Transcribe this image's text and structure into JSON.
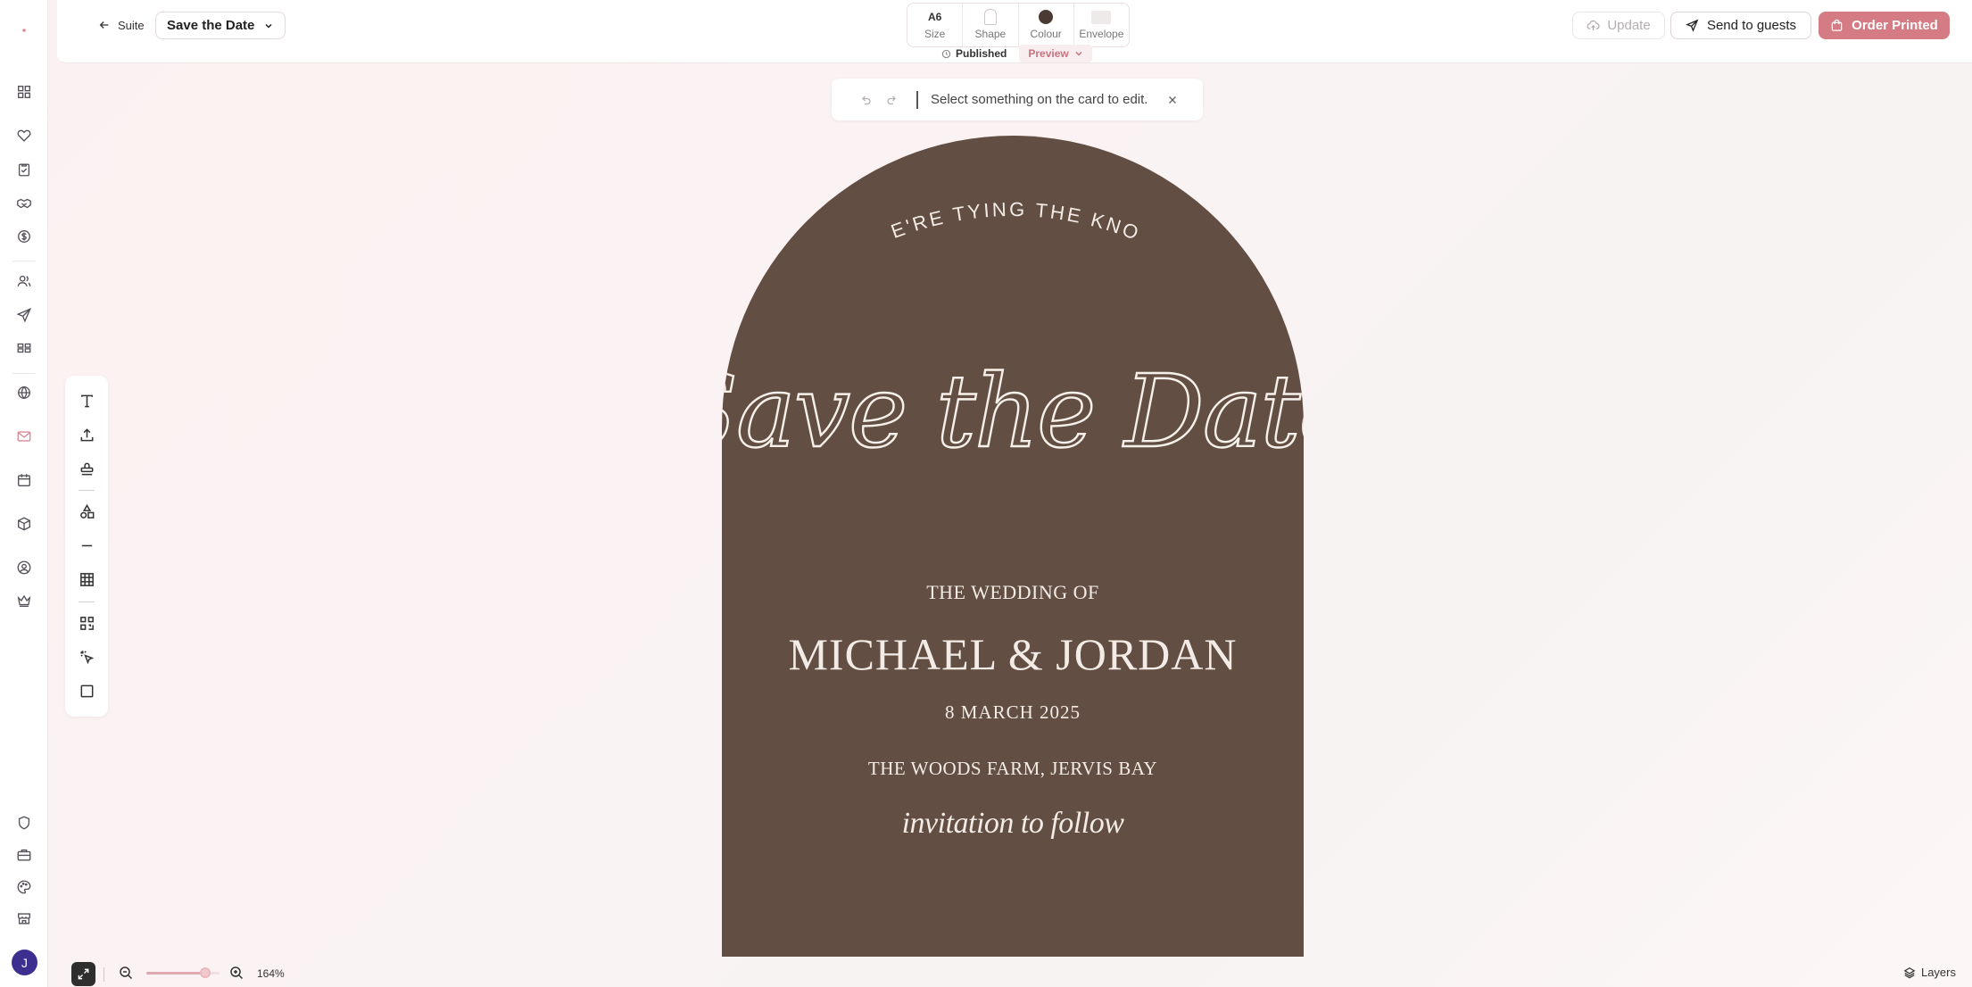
{
  "header": {
    "back_label": "Suite",
    "document_title": "Save the Date",
    "props": [
      {
        "value": "A6",
        "label": "Size"
      },
      {
        "value": "",
        "label": "Shape"
      },
      {
        "value": "",
        "label": "Colour"
      },
      {
        "value": "",
        "label": "Envelope"
      }
    ],
    "colour_swatch": "#4a3a33",
    "status": "Published",
    "preview_label": "Preview",
    "update_label": "Update",
    "send_label": "Send to guests",
    "order_label": "Order Printed",
    "accent": "#d47b84"
  },
  "hint": {
    "message": "Select something on the card to edit."
  },
  "card": {
    "background": "#624e43",
    "tying": "WE'RE TYING THE KNOT",
    "script_title": "Save the Date",
    "wedding_of": "THE WEDDING OF",
    "names": "MICHAEL & JORDAN",
    "date": "8 MARCH 2025",
    "venue": "THE WOODS FARM, JERVIS BAY",
    "follow": "invitation to follow"
  },
  "sidebar": {
    "icons": [
      "logo-icon",
      "grid-icon",
      "heart-icon",
      "checklist-icon",
      "handshake-icon",
      "dollar-icon",
      "guests-icon",
      "send-icon",
      "seating-icon",
      "globe-icon",
      "mail-icon",
      "calendar-icon",
      "box-icon",
      "user-circle-icon",
      "crown-icon",
      "shield-icon",
      "briefcase-icon",
      "palette-icon",
      "store-icon"
    ],
    "active": "mail-icon",
    "avatar_initial": "J"
  },
  "tools": [
    "text",
    "upload",
    "stamp",
    "shapes",
    "line",
    "table",
    "qr-code",
    "magic-select",
    "frame"
  ],
  "footer": {
    "zoom": "164%",
    "zoom_fraction": 0.85,
    "layers_label": "Layers"
  }
}
